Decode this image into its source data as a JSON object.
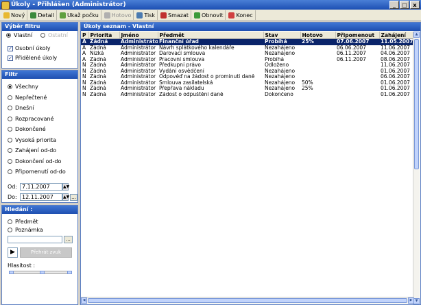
{
  "window": {
    "title": "Úkoly - Přihlášen (Administrátor)",
    "minimize": "_",
    "maximize": "□",
    "close": "x"
  },
  "toolbar": {
    "items": [
      {
        "label": "Nový",
        "icon": "new-icon",
        "color": "#e8b830"
      },
      {
        "label": "Detail",
        "icon": "detail-icon",
        "color": "#3c8a3c"
      },
      {
        "label": "Ukaž počku",
        "icon": "show-icon",
        "color": "#60a040"
      },
      {
        "label": "Hotovo",
        "icon": "done-icon",
        "color": "#b0b0b0",
        "disabled": true
      },
      {
        "label": "Tisk",
        "icon": "print-icon",
        "color": "#4a7ab0"
      },
      {
        "label": "Smazat",
        "icon": "delete-icon",
        "color": "#c03030"
      },
      {
        "label": "Obnovit",
        "icon": "refresh-icon",
        "color": "#3a9a3a"
      },
      {
        "label": "Konec",
        "icon": "exit-icon",
        "color": "#d04040"
      }
    ]
  },
  "select_filter": {
    "title": "Výběr filtru",
    "mode_own": "Vlastní",
    "mode_other": "Ostatní",
    "check_own": "Osobní úkoly",
    "check_assigned": "Přidělené úkoly"
  },
  "filter": {
    "title": "Filtr",
    "options": [
      "Všechny",
      "Nepřečtené",
      "Dnešní",
      "Rozpracované",
      "Dokončené",
      "Vysoká priorita",
      "Zahájení od-do",
      "Dokončení od-do",
      "Připomenutí od-do"
    ],
    "selected": 0,
    "from_label": "Od:",
    "from_value": "7.11.2007",
    "to_label": "Do:",
    "to_value": "12.11.2007",
    "dots": "..."
  },
  "search": {
    "title": "Hledání :",
    "subject": "Předmět",
    "note": "Poznámka",
    "search_value": "",
    "dots": "...",
    "recognize": "Přehrát zvuk",
    "volume_label": "Hlasitost :"
  },
  "list": {
    "title": "Úkoly seznam - Vlastní",
    "columns": [
      "P",
      "Priorita",
      "Jméno",
      "Předmět",
      "Stav",
      "Hotovo",
      "Připomenout",
      "Zahájení"
    ],
    "rows": [
      [
        "A",
        "Žádná",
        "Administrátor",
        "Finanční úřad",
        "Probíhá",
        "25%",
        "07.06.2007",
        "11.05.2007"
      ],
      [
        "A",
        "Žádná",
        "Administrátor",
        "Návrh splátkového kalendáře",
        "Nezahájeno",
        "",
        "06.06.2007",
        "11.06.2007"
      ],
      [
        "A",
        "Nízká",
        "Administrátor",
        "Darovací smlouva",
        "Nezahájeno",
        "",
        "06.11.2007",
        "04.06.2007"
      ],
      [
        "A",
        "Žádná",
        "Administrátor",
        "Pracovní smlouva",
        "Probíhá",
        "",
        "06.11.2007",
        "08.06.2007"
      ],
      [
        "N",
        "Žádná",
        "Administrátor",
        "Předkupní právo",
        "Odloženo",
        "",
        "",
        "11.06.2007"
      ],
      [
        "N",
        "Žádná",
        "Administrátor",
        "Vydání osvědčení",
        "Nezahájeno",
        "",
        "",
        "01.06.2007"
      ],
      [
        "N",
        "Žádná",
        "Administrátor",
        "Odpověď na žádost o prominutí daně",
        "Nezahájeno",
        "",
        "",
        "06.06.2007"
      ],
      [
        "N",
        "Žádná",
        "Administrátor",
        "Smlouva zasílatelská",
        "Nezahájeno",
        "50%",
        "",
        "01.06.2007"
      ],
      [
        "N",
        "Žádná",
        "Administrátor",
        "Přepřava nákladu",
        "Nezahájeno",
        "25%",
        "",
        "01.06.2007"
      ],
      [
        "N",
        "Žádná",
        "Administrátor",
        "Žádost o odpuštění daně",
        "Dokončeno",
        "",
        "",
        "01.06.2007"
      ]
    ]
  }
}
